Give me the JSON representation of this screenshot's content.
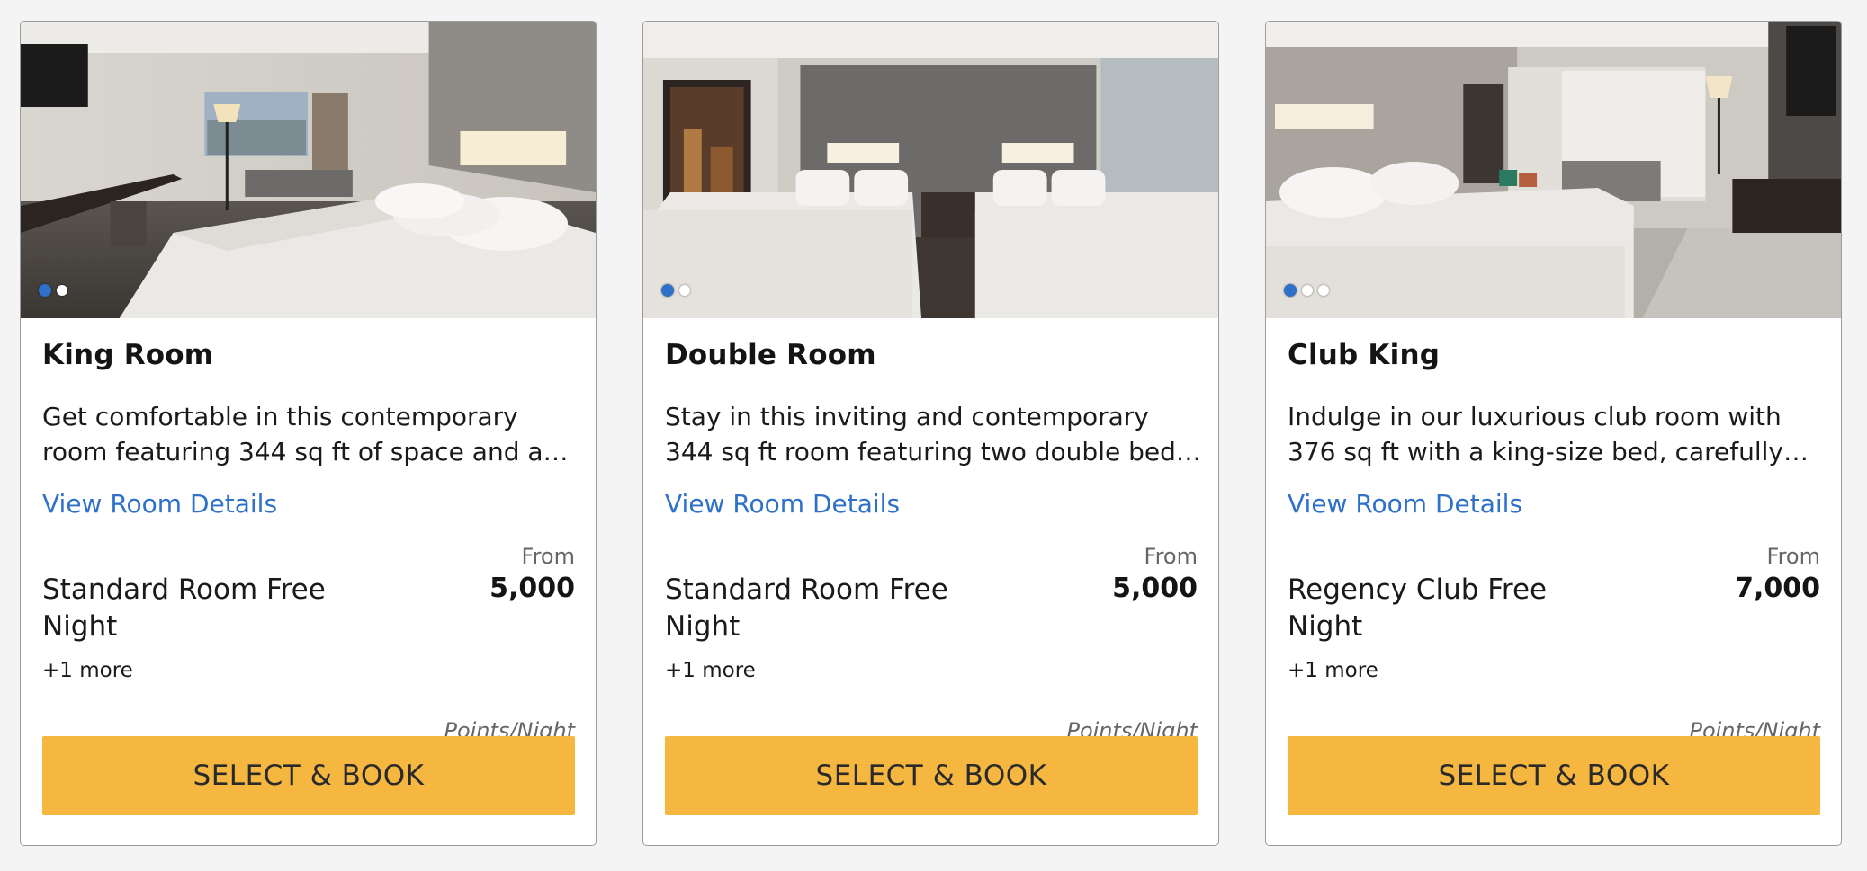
{
  "colors": {
    "accent_button": "#f5b740",
    "link": "#2f71c9",
    "active_dot": "#2f71c9",
    "page_background": "#f4f4f4"
  },
  "rooms": [
    {
      "name": "King Room",
      "description": "Get comfortable in this contemporary room featuring 344 sq ft of space and a king bed....",
      "details_link": "View Room Details",
      "from_label": "From",
      "rate_name": "Standard Room Free Night",
      "price": "5,000",
      "more_rates": "+1 more",
      "price_unit": "Points/Night",
      "book_label": "SELECT & BOOK",
      "photo": "king-bed-room-photo",
      "carousel": {
        "count": 2,
        "active_index": 0
      }
    },
    {
      "name": "Double Room",
      "description": "Stay in this inviting and contemporary 344 sq ft room featuring two double beds and a...",
      "details_link": "View Room Details",
      "from_label": "From",
      "rate_name": "Standard Room Free Night",
      "price": "5,000",
      "more_rates": "+1 more",
      "price_unit": "Points/Night",
      "book_label": "SELECT & BOOK",
      "photo": "two-double-beds-room-photo",
      "carousel": {
        "count": 2,
        "active_index": 0
      }
    },
    {
      "name": "Club King",
      "description": "Indulge in our luxurious club room with 376 sq ft with a king-size bed, carefully designe...",
      "details_link": "View Room Details",
      "from_label": "From",
      "rate_name": "Regency Club Free Night",
      "price": "7,000",
      "more_rates": "+1 more",
      "price_unit": "Points/Night",
      "book_label": "SELECT & BOOK",
      "photo": "club-king-room-photo",
      "carousel": {
        "count": 3,
        "active_index": 0
      }
    }
  ]
}
